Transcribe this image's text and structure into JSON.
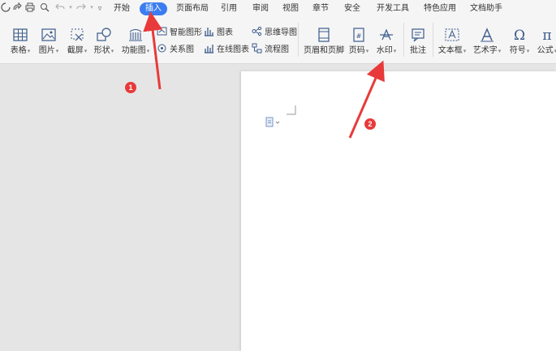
{
  "tabs": [
    "开始",
    "插入",
    "页面布局",
    "引用",
    "审阅",
    "视图",
    "章节",
    "安全",
    "开发工具",
    "特色应用",
    "文档助手"
  ],
  "active_tab": "插入",
  "ribbon": {
    "table": "表格",
    "picture": "图片",
    "screenshot": "截屏",
    "shapes": "形状",
    "function_chart": "功能图",
    "smart_art": "智能图形",
    "chart": "图表",
    "mind_map": "思维导图",
    "relation_chart": "关系图",
    "online_chart": "在线图表",
    "flowchart": "流程图",
    "header_footer": "页眉和页脚",
    "page_number": "页码",
    "watermark": "水印",
    "comment": "批注",
    "text_box": "文本框",
    "word_art": "艺术字",
    "symbol": "符号",
    "formula": "公式"
  },
  "annotations": {
    "badge1": "1",
    "badge2": "2",
    "color": "#e83a3a"
  },
  "accent_color": "#3b7df0"
}
